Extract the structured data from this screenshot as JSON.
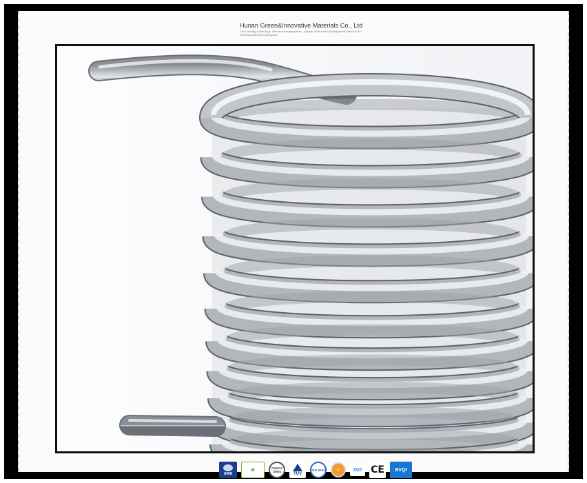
{
  "header": {
    "company_name": "Hunan Green&Innovative Materials Co., Ltd",
    "tagline": "The Leading technology. Advanced management . unique culture and distinguished brand of the internationalization enterprise"
  },
  "photo": {
    "subject": "coiled-tube-icon",
    "colors": {
      "metal_light": "#e9eaec",
      "metal_mid": "#b9bcc2",
      "metal_dark": "#7e828a",
      "background": "#f7f7f9"
    }
  },
  "certifications": [
    {
      "id": "grin",
      "label": "GRIN",
      "icon": "company-logo-icon"
    },
    {
      "id": "green",
      "label": "",
      "icon": "green-cert-icon"
    },
    {
      "id": "ohsas",
      "label": "OHSAS 18001",
      "icon": "ohsas-seal-icon"
    },
    {
      "id": "tuv",
      "label": "TÜV",
      "icon": "tuv-icon"
    },
    {
      "id": "iso9001",
      "label": "ISO 9001",
      "icon": "iso9001-seal-icon"
    },
    {
      "id": "orange",
      "label": "",
      "icon": "orange-seal-icon"
    },
    {
      "id": "iso",
      "label": "ISO",
      "icon": "iso-icon"
    },
    {
      "id": "ce",
      "label": "CE",
      "icon": "ce-mark-icon"
    },
    {
      "id": "bvqi",
      "label": "BVQI",
      "icon": "bvqi-icon"
    }
  ]
}
